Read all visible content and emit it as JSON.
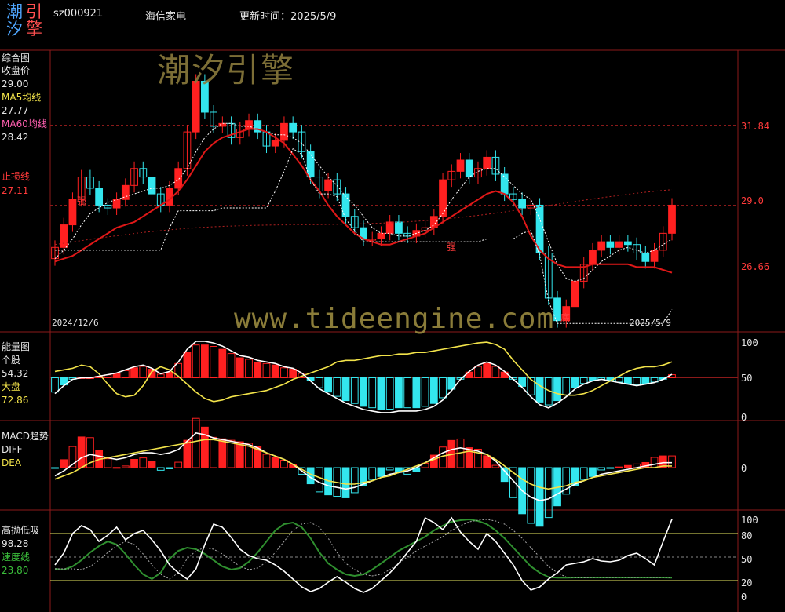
{
  "header": {
    "logo": [
      "潮",
      "引",
      "汐",
      "擎"
    ],
    "code": "sz000921",
    "name": "海信家电",
    "update_label": "更新时间：2025/5/9"
  },
  "watermarks": {
    "brand": "潮汐引擎",
    "url": "www.tideengine.com"
  },
  "panel_main": {
    "title": "综合图",
    "close_label": "收盘价",
    "close_value": "29.00",
    "ma5_label": "MA5均线",
    "ma5_value": "27.77",
    "ma60_label": "MA60均线",
    "ma60_value": "28.42",
    "stop_label": "止损线",
    "stop_value": "27.11",
    "right_labels": [
      "31.84",
      "29.0",
      "26.66"
    ],
    "date_start": "2024/12/6",
    "date_end": "2025/5/9",
    "annotations": [
      "强",
      "强",
      "底"
    ]
  },
  "panel_energy": {
    "title": "能量图",
    "stock_label": "个股",
    "stock_value": "54.32",
    "market_label": "大盘",
    "market_value": "72.86",
    "right_labels": [
      "100",
      "50",
      "0"
    ]
  },
  "panel_macd": {
    "title": "MACD趋势",
    "diff_label": "DIFF",
    "dea_label": "DEA",
    "right_labels": [
      "0"
    ]
  },
  "panel_gaopao": {
    "title": "高抛低吸",
    "value": "98.28",
    "speed_label": "速度线",
    "speed_value": "23.80",
    "right_labels": [
      "100",
      "80",
      "50",
      "20",
      "0"
    ]
  },
  "colors": {
    "up": "#ff2020",
    "down": "#33e6ee",
    "ma60": "#e01818",
    "grid": "#8b1a1a",
    "white": "#ffffff",
    "yellow": "#f2e34a",
    "green": "#2f8f2f"
  },
  "chart_data": [
    {
      "type": "candlestick",
      "title": "综合图",
      "x_range": [
        "2024/12/6",
        "2025/5/9"
      ],
      "ylim": [
        24.5,
        34.5
      ],
      "y_ticks": [
        31.84,
        29.0,
        26.66
      ],
      "series": [
        {
          "name": "收盘价",
          "values": [
            27.5,
            28.3,
            29.2,
            30.0,
            29.6,
            29.0,
            28.9,
            29.2,
            29.7,
            30.3,
            30.0,
            29.4,
            29.0,
            29.6,
            30.3,
            31.6,
            33.4,
            32.3,
            31.8,
            31.9,
            31.4,
            31.7,
            32.0,
            31.6,
            31.1,
            31.3,
            31.9,
            31.6,
            30.9,
            30.0,
            29.5,
            29.9,
            29.4,
            28.6,
            28.2,
            27.8,
            27.8,
            28.0,
            28.4,
            28.0,
            27.9,
            28.1,
            28.2,
            28.6,
            29.9,
            30.2,
            30.6,
            30.0,
            30.3,
            30.7,
            30.1,
            29.4,
            29.2,
            28.9,
            29.0,
            27.3,
            25.7,
            24.9,
            25.4,
            26.3,
            26.9,
            27.4,
            27.7,
            27.5,
            27.7,
            27.6,
            27.3,
            27.0,
            27.4,
            28.0,
            29.0
          ]
        },
        {
          "name": "MA5均线",
          "values": [
            27.1,
            27.4,
            27.8,
            28.3,
            28.7,
            28.9,
            29.1,
            29.2,
            29.3,
            29.4,
            29.5,
            29.6,
            29.6,
            29.7,
            29.9,
            30.3,
            30.9,
            31.4,
            31.7,
            31.9,
            31.9,
            31.8,
            31.8,
            31.7,
            31.6,
            31.5,
            31.5,
            31.4,
            31.2,
            30.8,
            30.4,
            30.0,
            29.7,
            29.3,
            29.0,
            28.6,
            28.2,
            28.0,
            28.0,
            27.9,
            27.9,
            28.0,
            28.1,
            28.3,
            28.7,
            29.2,
            29.6,
            30.0,
            30.2,
            30.3,
            30.3,
            30.0,
            29.7,
            29.4,
            29.2,
            28.5,
            27.7,
            26.9,
            26.4,
            26.3,
            26.4,
            26.7,
            27.0,
            27.2,
            27.4,
            27.5,
            27.4,
            27.3,
            27.4,
            27.6,
            27.8
          ]
        },
        {
          "name": "MA60均线",
          "values": [
            27.0,
            27.1,
            27.2,
            27.4,
            27.6,
            27.8,
            28.0,
            28.2,
            28.3,
            28.4,
            28.6,
            28.8,
            29.0,
            29.2,
            29.5,
            29.9,
            30.4,
            30.9,
            31.2,
            31.4,
            31.5,
            31.6,
            31.7,
            31.7,
            31.6,
            31.4,
            31.2,
            30.8,
            30.4,
            29.9,
            29.5,
            29.0,
            28.6,
            28.3,
            28.0,
            27.8,
            27.7,
            27.6,
            27.6,
            27.7,
            27.8,
            27.9,
            28.0,
            28.2,
            28.4,
            28.6,
            28.8,
            29.0,
            29.2,
            29.4,
            29.5,
            29.4,
            29.1,
            28.6,
            27.9,
            27.4,
            27.1,
            26.9,
            26.8,
            26.8,
            26.8,
            26.9,
            26.9,
            26.9,
            26.9,
            26.9,
            26.8,
            26.8,
            26.8,
            26.7,
            26.6
          ]
        },
        {
          "name": "止损线",
          "values": [
            27.11
          ]
        }
      ]
    },
    {
      "type": "bar",
      "title": "能量图",
      "ylim": [
        0,
        100
      ],
      "y_ticks": [
        100,
        50,
        0
      ],
      "series": [
        {
          "name": "个股",
          "values": [
            58,
            60,
            62,
            66,
            64,
            55,
            42,
            30,
            26,
            28,
            40,
            58,
            64,
            60,
            52,
            42,
            32,
            24,
            20,
            22,
            26,
            28,
            30,
            32,
            34,
            38,
            42,
            48,
            52,
            56,
            60,
            64,
            70,
            72,
            72,
            74,
            76,
            78,
            78,
            80,
            80,
            82,
            82,
            84,
            86,
            88,
            90,
            92,
            94,
            95,
            92,
            86,
            72,
            60,
            48,
            40,
            34,
            30,
            28,
            28,
            30,
            34,
            40,
            46,
            52,
            58,
            62,
            64,
            64,
            66,
            70
          ]
        },
        {
          "name": "大盘",
          "values": [
            30,
            40,
            48,
            50,
            50,
            52,
            54,
            56,
            60,
            64,
            66,
            62,
            55,
            58,
            70,
            86,
            96,
            96,
            94,
            90,
            84,
            78,
            76,
            72,
            70,
            68,
            64,
            62,
            56,
            46,
            36,
            30,
            24,
            18,
            14,
            10,
            8,
            6,
            6,
            8,
            8,
            8,
            10,
            14,
            22,
            34,
            48,
            58,
            66,
            70,
            66,
            58,
            48,
            38,
            26,
            16,
            12,
            18,
            26,
            36,
            42,
            46,
            48,
            46,
            44,
            42,
            40,
            42,
            44,
            48,
            54.32
          ]
        }
      ]
    },
    {
      "type": "bar",
      "title": "MACD趋势",
      "series": [
        {
          "name": "DIFF",
          "values": [
            -0.5,
            -0.2,
            0.2,
            0.6,
            0.8,
            0.7,
            0.6,
            0.5,
            0.6,
            0.8,
            0.9,
            0.9,
            0.8,
            0.9,
            1.1,
            1.6,
            2.1,
            2.0,
            1.8,
            1.7,
            1.6,
            1.5,
            1.4,
            1.2,
            0.9,
            0.7,
            0.5,
            0.2,
            -0.2,
            -0.6,
            -0.9,
            -1.1,
            -1.2,
            -1.3,
            -1.2,
            -1.0,
            -0.8,
            -0.6,
            -0.4,
            -0.3,
            -0.2,
            0.0,
            0.3,
            0.6,
            0.9,
            1.1,
            1.2,
            1.1,
            1.0,
            0.8,
            0.4,
            -0.2,
            -0.8,
            -1.4,
            -1.8,
            -2.0,
            -1.9,
            -1.6,
            -1.3,
            -1.0,
            -0.8,
            -0.6,
            -0.4,
            -0.3,
            -0.2,
            -0.1,
            0.0,
            0.1,
            0.2,
            0.3,
            0.3
          ]
        },
        {
          "name": "DEA",
          "values": [
            -0.7,
            -0.5,
            -0.3,
            0.0,
            0.3,
            0.5,
            0.6,
            0.7,
            0.8,
            0.9,
            1.0,
            1.1,
            1.2,
            1.3,
            1.4,
            1.5,
            1.6,
            1.7,
            1.7,
            1.6,
            1.5,
            1.4,
            1.3,
            1.1,
            0.9,
            0.7,
            0.5,
            0.2,
            -0.1,
            -0.4,
            -0.6,
            -0.8,
            -0.9,
            -1.0,
            -1.0,
            -0.9,
            -0.8,
            -0.6,
            -0.5,
            -0.3,
            -0.1,
            0.1,
            0.3,
            0.5,
            0.7,
            0.8,
            0.9,
            1.0,
            0.9,
            0.8,
            0.5,
            0.1,
            -0.3,
            -0.7,
            -1.0,
            -1.2,
            -1.3,
            -1.2,
            -1.1,
            -0.9,
            -0.8,
            -0.6,
            -0.5,
            -0.4,
            -0.3,
            -0.2,
            -0.1,
            0.0,
            0.0,
            0.1,
            0.1
          ]
        }
      ]
    },
    {
      "type": "line",
      "title": "高抛低吸",
      "ylim": [
        0,
        100
      ],
      "y_ticks": [
        100,
        80,
        50,
        20,
        0
      ],
      "series": [
        {
          "name": "高抛低吸",
          "values": [
            40,
            55,
            80,
            90,
            85,
            70,
            78,
            88,
            72,
            80,
            84,
            72,
            58,
            40,
            30,
            22,
            35,
            66,
            92,
            88,
            75,
            60,
            52,
            48,
            46,
            40,
            32,
            22,
            12,
            6,
            10,
            18,
            25,
            18,
            10,
            5,
            10,
            20,
            30,
            42,
            56,
            70,
            100,
            94,
            85,
            100,
            82,
            70,
            60,
            80,
            70,
            55,
            40,
            20,
            8,
            12,
            22,
            30,
            40,
            42,
            44,
            48,
            45,
            44,
            46,
            52,
            55,
            48,
            40,
            70,
            98.28
          ]
        },
        {
          "name": "速度线",
          "values": [
            35,
            34,
            38,
            46,
            56,
            64,
            70,
            66,
            54,
            40,
            28,
            22,
            30,
            48,
            58,
            62,
            60,
            54,
            46,
            38,
            34,
            36,
            44,
            56,
            70,
            84,
            92,
            94,
            88,
            74,
            56,
            42,
            34,
            28,
            26,
            28,
            34,
            42,
            50,
            58,
            64,
            70,
            76,
            84,
            90,
            95,
            97,
            98,
            96,
            92,
            84,
            74,
            62,
            50,
            38,
            30,
            24.5,
            23.8,
            23.8,
            24,
            24,
            24,
            24,
            24,
            24,
            24,
            24,
            24,
            24,
            24,
            23.8
          ]
        }
      ]
    }
  ]
}
